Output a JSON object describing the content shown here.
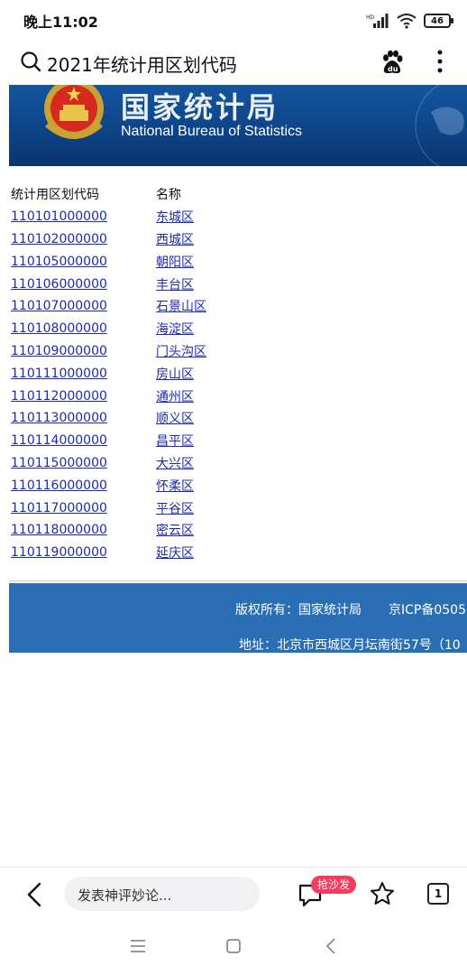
{
  "status_bar": {
    "time": "晚上11:02",
    "battery": "46",
    "network_label": "HD"
  },
  "address_bar": {
    "query": "2021年统计用区划代码",
    "icons": [
      "search-icon",
      "baidu-paw-icon",
      "more-vertical-icon"
    ]
  },
  "banner": {
    "title_cn": "国家统计局",
    "title_en": "National Bureau of Statistics"
  },
  "table": {
    "headers": [
      "统计用区划代码",
      "名称"
    ],
    "rows": [
      {
        "code": "110101000000",
        "name": "东城区"
      },
      {
        "code": "110102000000",
        "name": "西城区"
      },
      {
        "code": "110105000000",
        "name": "朝阳区"
      },
      {
        "code": "110106000000",
        "name": "丰台区"
      },
      {
        "code": "110107000000",
        "name": "石景山区"
      },
      {
        "code": "110108000000",
        "name": "海淀区"
      },
      {
        "code": "110109000000",
        "name": "门头沟区"
      },
      {
        "code": "110111000000",
        "name": "房山区"
      },
      {
        "code": "110112000000",
        "name": "通州区"
      },
      {
        "code": "110113000000",
        "name": "顺义区"
      },
      {
        "code": "110114000000",
        "name": "昌平区"
      },
      {
        "code": "110115000000",
        "name": "大兴区"
      },
      {
        "code": "110116000000",
        "name": "怀柔区"
      },
      {
        "code": "110117000000",
        "name": "平谷区"
      },
      {
        "code": "110118000000",
        "name": "密云区"
      },
      {
        "code": "110119000000",
        "name": "延庆区"
      }
    ]
  },
  "footer": {
    "copyright": "版权所有：国家统计局",
    "icp": "京ICP备0505",
    "address": "地址：北京市西城区月坛南街57号（10"
  },
  "toolbar": {
    "comment_placeholder": "发表神评妙论...",
    "sofa_badge": "抢沙发",
    "tab_count": "1"
  },
  "colors": {
    "link": "#1d2bb0",
    "banner": "#0d4286",
    "footer": "#2a6fb4",
    "badge": "#f43d5e"
  }
}
